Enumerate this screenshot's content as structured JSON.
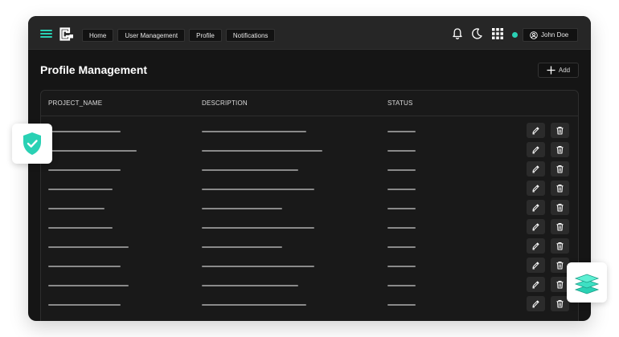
{
  "topbar": {
    "nav": [
      {
        "label": "Home"
      },
      {
        "label": "User Management"
      },
      {
        "label": "Profile"
      },
      {
        "label": "Notifications"
      }
    ],
    "user_name": "John Doe"
  },
  "page": {
    "title": "Profile Management",
    "add_label": "Add"
  },
  "table": {
    "columns": [
      "PROJECT_NAME",
      "DESCRIPTION",
      "STATUS"
    ],
    "row_count": 10
  },
  "colors": {
    "accent": "#2ad1b4",
    "panel": "#191919",
    "background": "#151515"
  },
  "icons": {
    "menu": "hamburger-menu-icon",
    "bell": "bell-icon",
    "theme": "moon-icon",
    "apps": "grid-icon",
    "user": "user-icon",
    "add": "plus-icon",
    "edit": "pencil-icon",
    "delete": "trash-icon",
    "shield": "shield-check-icon",
    "layers": "layers-icon"
  }
}
